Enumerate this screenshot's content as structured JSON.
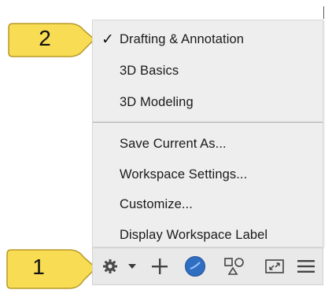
{
  "callouts": [
    {
      "number": "2"
    },
    {
      "number": "1"
    }
  ],
  "workspace_menu": {
    "items": [
      {
        "label": "Drafting & Annotation",
        "checked": true
      },
      {
        "label": "3D Basics",
        "checked": false
      },
      {
        "label": "3D Modeling",
        "checked": false
      },
      {
        "label": "Save Current As...",
        "checked": false
      },
      {
        "label": "Workspace Settings...",
        "checked": false
      },
      {
        "label": "Customize...",
        "checked": false
      },
      {
        "label": "Display Workspace Label",
        "checked": false
      }
    ],
    "check_glyph": "✓"
  },
  "status_bar": {
    "icons": [
      "gear-icon",
      "dropdown-arrow-icon",
      "plus-icon",
      "isolate-objects-icon",
      "annotation-scale-icon",
      "fullscreen-icon",
      "hamburger-menu-icon"
    ]
  },
  "colors": {
    "callout_fill": "#f7dc54",
    "callout_stroke": "#b89a2a",
    "menu_bg": "#eeeeee",
    "statusbar_bg": "#e9e9e9",
    "accent_blue": "#2f6fc2"
  }
}
